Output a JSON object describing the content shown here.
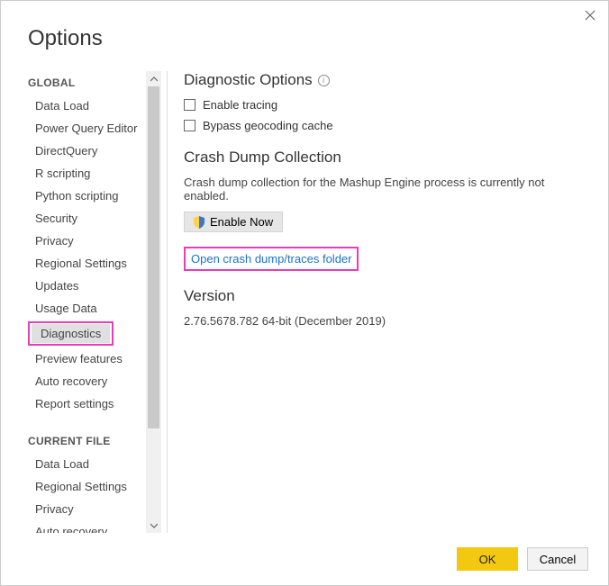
{
  "title": "Options",
  "sidebar": {
    "sections": [
      {
        "header": "GLOBAL",
        "items": [
          {
            "label": "Data Load",
            "selected": false
          },
          {
            "label": "Power Query Editor",
            "selected": false
          },
          {
            "label": "DirectQuery",
            "selected": false
          },
          {
            "label": "R scripting",
            "selected": false
          },
          {
            "label": "Python scripting",
            "selected": false
          },
          {
            "label": "Security",
            "selected": false
          },
          {
            "label": "Privacy",
            "selected": false
          },
          {
            "label": "Regional Settings",
            "selected": false
          },
          {
            "label": "Updates",
            "selected": false
          },
          {
            "label": "Usage Data",
            "selected": false
          },
          {
            "label": "Diagnostics",
            "selected": true
          },
          {
            "label": "Preview features",
            "selected": false
          },
          {
            "label": "Auto recovery",
            "selected": false
          },
          {
            "label": "Report settings",
            "selected": false
          }
        ]
      },
      {
        "header": "CURRENT FILE",
        "items": [
          {
            "label": "Data Load",
            "selected": false
          },
          {
            "label": "Regional Settings",
            "selected": false
          },
          {
            "label": "Privacy",
            "selected": false
          },
          {
            "label": "Auto recovery",
            "selected": false
          }
        ]
      }
    ]
  },
  "main": {
    "diag_heading": "Diagnostic Options",
    "enable_tracing": "Enable tracing",
    "bypass_geocoding": "Bypass geocoding cache",
    "crash_heading": "Crash Dump Collection",
    "crash_text": "Crash dump collection for the Mashup Engine process is currently not enabled.",
    "enable_now": "Enable Now",
    "open_folder_link": "Open crash dump/traces folder",
    "version_heading": "Version",
    "version_text": "2.76.5678.782 64-bit (December 2019)"
  },
  "footer": {
    "ok": "OK",
    "cancel": "Cancel"
  }
}
